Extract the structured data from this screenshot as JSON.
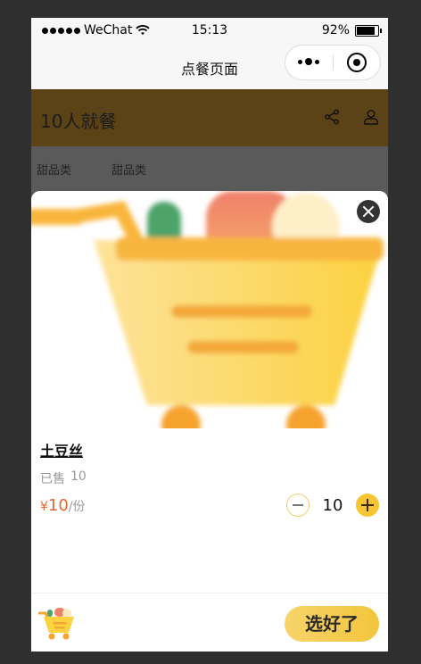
{
  "status_bar": {
    "carrier": "WeChat",
    "time": "15:13",
    "battery": "92%"
  },
  "nav": {
    "title": "点餐页面"
  },
  "header": {
    "title": "10人就餐"
  },
  "categories": [
    {
      "label": "甜品类"
    },
    {
      "label": "甜品类"
    }
  ],
  "product": {
    "name": "土豆丝",
    "sold_label": "已售",
    "sold_count": "10",
    "currency": "¥",
    "price": "10",
    "unit": "/份",
    "quantity": "10"
  },
  "footer": {
    "confirm_label": "选好了"
  },
  "colors": {
    "accent": "#f5c533",
    "price": "#e8662b",
    "header": "#6b4e1c"
  },
  "icons": [
    "signal-dots-icon",
    "wifi-icon",
    "battery-icon",
    "more-icon",
    "close-mini-program-icon",
    "share-icon",
    "user-icon",
    "close-icon",
    "minus-icon",
    "plus-icon",
    "cart-icon"
  ]
}
